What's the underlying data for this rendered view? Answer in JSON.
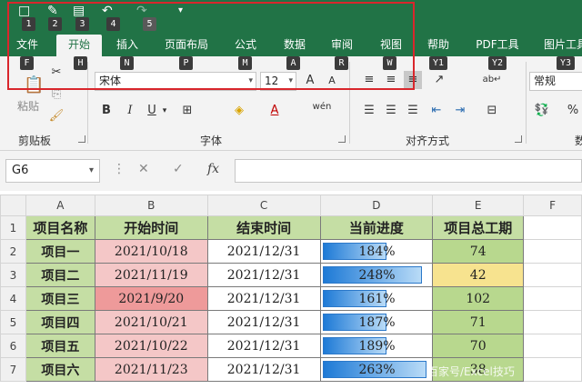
{
  "quick_access": {
    "keytips": [
      "1",
      "2",
      "3",
      "4",
      "5"
    ]
  },
  "tabs": [
    {
      "label": "文件",
      "keytip": "F",
      "active": false
    },
    {
      "label": "开始",
      "keytip": "H",
      "active": true
    },
    {
      "label": "插入",
      "keytip": "N",
      "active": false
    },
    {
      "label": "页面布局",
      "keytip": "P",
      "active": false
    },
    {
      "label": "公式",
      "keytip": "M",
      "active": false
    },
    {
      "label": "数据",
      "keytip": "A",
      "active": false
    },
    {
      "label": "审阅",
      "keytip": "R",
      "active": false
    },
    {
      "label": "视图",
      "keytip": "W",
      "active": false
    },
    {
      "label": "帮助",
      "keytip": "Y1",
      "active": false
    },
    {
      "label": "PDF工具",
      "keytip": "Y2",
      "active": false
    },
    {
      "label": "图片工具",
      "keytip": "Y3",
      "active": false
    }
  ],
  "ribbon": {
    "clipboard": {
      "label": "剪贴板",
      "paste_label": "粘贴"
    },
    "font": {
      "label": "字体",
      "font_name": "宋体",
      "font_size": "12",
      "bold": "B",
      "italic": "I",
      "underline": "U",
      "grow": "A",
      "shrink": "A",
      "phonetic": "wén"
    },
    "alignment": {
      "label": "对齐方式"
    },
    "number": {
      "label": "数",
      "format": "常规"
    }
  },
  "formula_bar": {
    "name_box": "G6",
    "formula": ""
  },
  "sheet": {
    "columns": [
      "A",
      "B",
      "C",
      "D",
      "E",
      "F"
    ],
    "header_row": [
      "项目名称",
      "开始时间",
      "结束时间",
      "当前进度",
      "项目总工期"
    ],
    "rows": [
      {
        "num": "2",
        "name": "项目一",
        "start": "2021/10/18",
        "end": "2021/12/31",
        "progress": "184%",
        "fill": 0.58,
        "total": "74"
      },
      {
        "num": "3",
        "name": "项目二",
        "start": "2021/11/19",
        "end": "2021/12/31",
        "progress": "248%",
        "fill": 0.91,
        "total": "42"
      },
      {
        "num": "4",
        "name": "项目三",
        "start": "2021/9/20",
        "end": "2021/12/31",
        "progress": "161%",
        "fill": 0.58,
        "total": "102"
      },
      {
        "num": "5",
        "name": "项目四",
        "start": "2021/10/21",
        "end": "2021/12/31",
        "progress": "187%",
        "fill": 0.58,
        "total": "71"
      },
      {
        "num": "6",
        "name": "项目五",
        "start": "2021/10/22",
        "end": "2021/12/31",
        "progress": "189%",
        "fill": 0.58,
        "total": "70"
      },
      {
        "num": "7",
        "name": "项目六",
        "start": "2021/11/23",
        "end": "2021/12/31",
        "progress": "263%",
        "fill": 0.95,
        "total": "38"
      }
    ],
    "colors": {
      "header_green": "#c5dea4",
      "start_red_light": "#f4c7c7",
      "start_red_dark": "#ee9a9a",
      "total_green": "#b8d88e",
      "total_yellow": "#f7e38f",
      "bar_blue": "#1e7ad6"
    }
  },
  "watermark": "百家号/Excel技巧"
}
